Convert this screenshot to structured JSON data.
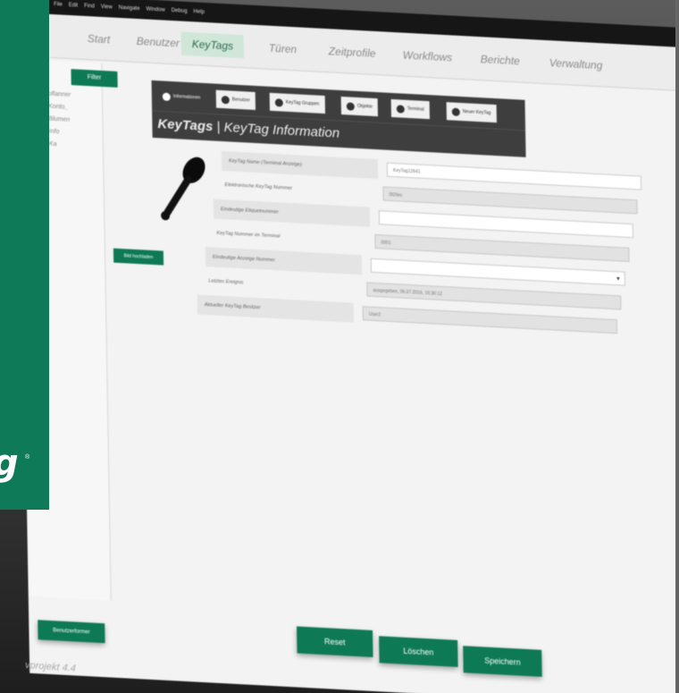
{
  "menubar": [
    "File",
    "Edit",
    "Find",
    "View",
    "Navigate",
    "Window",
    "Debug",
    "Help"
  ],
  "nav_tabs": [
    {
      "label": "Start"
    },
    {
      "label": "Benutzer"
    },
    {
      "label": "KeyTags",
      "active": true
    },
    {
      "label": "Türen"
    },
    {
      "label": "Zeitprofile"
    },
    {
      "label": "Workflows"
    },
    {
      "label": "Berichte"
    },
    {
      "label": "Verwaltung"
    }
  ],
  "sidebar": {
    "filter_label": "Filter",
    "items": [
      "pflanner",
      "Konto_",
      "Blumen",
      "Info",
      "Ka",
      "",
      "",
      "",
      "",
      "",
      ""
    ]
  },
  "content_tabs": [
    {
      "label": "Informationen",
      "active": true,
      "icon": "info-icon"
    },
    {
      "label": "Benutzer",
      "icon": "user-icon"
    },
    {
      "label": "KeyTag Gruppen",
      "icon": "group-icon"
    },
    {
      "label": "Objekte",
      "icon": "link-icon"
    },
    {
      "label": "Terminal",
      "icon": "terminal-icon"
    },
    {
      "label": "Neuer KeyTag",
      "icon": "add-icon"
    }
  ],
  "panel": {
    "title_bold": "KeyTags",
    "title_rest": "| KeyTag Information"
  },
  "image_button": "Bild hochladen",
  "fields": [
    {
      "label": "KeyTag Name (Terminal Anzeige)",
      "value": "KeyTag12641",
      "readonly": false
    },
    {
      "label": "Elektronische KeyTag Nummer",
      "value": "0f29ec",
      "readonly": true
    },
    {
      "label": "Eindeutige Etiquetnummer",
      "value": "",
      "readonly": false
    },
    {
      "label": "KeyTag Nummer im Terminal",
      "value": "0001",
      "readonly": true
    },
    {
      "label": "Eindeutige Anzeige Nummer",
      "value": "",
      "readonly": false,
      "dropdown": true
    },
    {
      "label": "Letztes Ereignis",
      "value": "ausgegeben, 06.07.2016, 16:36:12",
      "readonly": true
    },
    {
      "label": "Aktueller KeyTag Besitzer",
      "value": "User2",
      "readonly": true
    }
  ],
  "actions": {
    "reset": "Reset",
    "delete": "Löschen",
    "save": "Speichern",
    "bottom_left": "Benutzerformer"
  },
  "footer_text": "vprojekt 4.4"
}
